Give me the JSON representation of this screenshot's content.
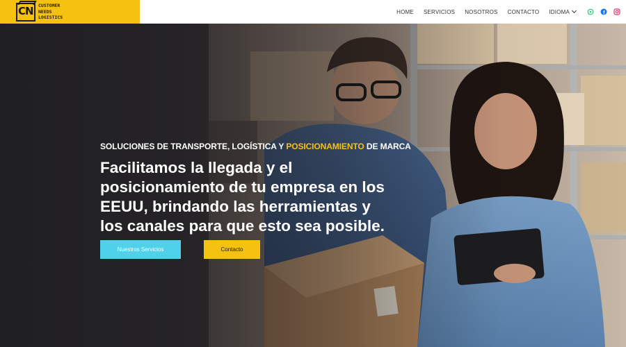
{
  "logo": {
    "mark_text": "CN",
    "line1": "CUSTOMER",
    "line2": "NEEDS",
    "line3": "LOGISTICS"
  },
  "nav": {
    "items": [
      "HOME",
      "SERVICIOS",
      "NOSOTROS",
      "CONTACTO"
    ],
    "dropdown_label": "IDIOMA",
    "social_icons": [
      "whatsapp-icon",
      "facebook-icon",
      "instagram-icon"
    ]
  },
  "hero": {
    "kicker_part1": "SOLUCIONES DE TRANSPORTE, LOGÍSTICA Y ",
    "kicker_highlight": "POSICIONAMIENTO",
    "kicker_part2": " DE MARCA",
    "headline": "Facilitamos la llegada y el posicionamiento de tu empresa en los EEUU, brindando las herramientas y los canales para que esto sea posible.",
    "button_services": "Nuestros Servicios",
    "button_contact": "Contacto"
  },
  "colors": {
    "brand_yellow": "#f5c211",
    "button_cyan": "#4fd1ea",
    "header_bg": "#ffffff"
  }
}
